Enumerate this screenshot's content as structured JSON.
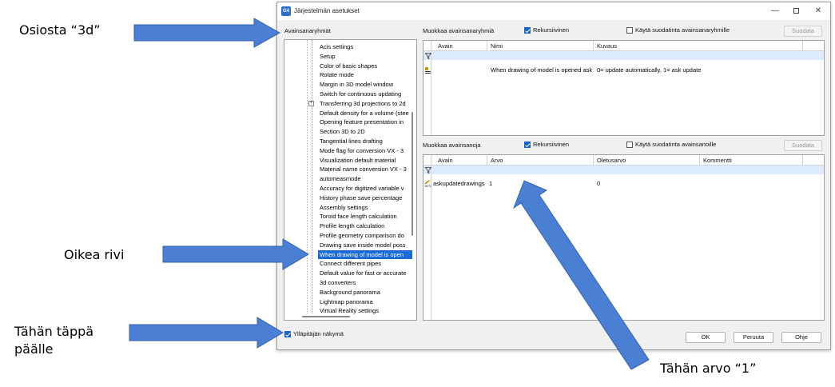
{
  "annotations": {
    "osiosta": "Osiosta “3d”",
    "oikea_rivi": "Oikea rivi",
    "tahan_tappa_line1": "Tähän täppä",
    "tahan_tappa_line2": "päälle",
    "tahan_arvo": "Tähän arvo “1”"
  },
  "window": {
    "icon_text": "G4",
    "title": "Järjestelmän asetukset",
    "minimize": "—",
    "close": "✕"
  },
  "left": {
    "label": "Avainsanaryhmät",
    "tree": [
      "Acis settings",
      "Setup",
      "Color of basic shapes",
      "Rotate mode",
      "Margin in 3D model window",
      "Switch for continuous updating",
      "Transferring 3d projections to 2d",
      "Default density for a volume (stee",
      "Opening feature presentation in",
      "Section 3D to 2D",
      "Tangential lines drafting",
      "Mode flag for conversion VX - 3",
      "Visualization default material",
      "Material name conversion VX - 3",
      "automeasmode",
      "Accuracy for digitized variable v",
      "History phase save percentage",
      "Assembly settings",
      "Toroid face length calculation",
      "Profile length calculation",
      "Profile geometry comparison do",
      "Drawing save inside model poss",
      "When drawing of model is open",
      "Connect different pipes",
      "Default value for fast or accurate",
      "3d converters",
      "Background panorama",
      "Lightmap panorama",
      "Virtual Reality settings"
    ],
    "selected_index": 22,
    "expander_index": 6,
    "admin_checkbox": {
      "label": "Ylläpitäjän näkymä",
      "checked": true
    }
  },
  "groups": {
    "label": "Muokkaa avainsanaryhmiä",
    "recursive": {
      "label": "Rekursiivinen",
      "checked": true
    },
    "use_filter": {
      "label": "Käytä suodatinta avainsanaryhmille",
      "checked": false
    },
    "filter_button": "Suodata",
    "columns": [
      "Avain",
      "Nimi",
      "Kuvaus"
    ],
    "rows": [
      {
        "key": "",
        "name": "When drawing of model is opened ask ...",
        "description": "0= update automatically, 1= ask update"
      }
    ]
  },
  "keys": {
    "label": "Muokkaa avainsanoja",
    "recursive": {
      "label": "Rekursiivinen",
      "checked": true
    },
    "use_filter": {
      "label": "Käytä suodatinta avainsanoille",
      "checked": false
    },
    "filter_button": "Suodata",
    "columns": [
      "Avain",
      "Arvo",
      "Oletusarvo",
      "Kommentti"
    ],
    "rows": [
      {
        "key": "askupdatedrawings",
        "value": "1",
        "default": "0",
        "comment": ""
      }
    ]
  },
  "footer": {
    "ok": "OK",
    "cancel": "Peruuta",
    "help": "Ohje"
  },
  "colors": {
    "arrow_fill": "#4a7fd3",
    "selection": "#1a6bd6",
    "filter_row": "#dcebfd",
    "checkbox_on": "#1a64c8"
  },
  "icons": {
    "filter": "funnel-icon",
    "group_row": "key-group-icon",
    "key_row": "keyword-beta-icon",
    "expander": "plus-expander-icon"
  }
}
